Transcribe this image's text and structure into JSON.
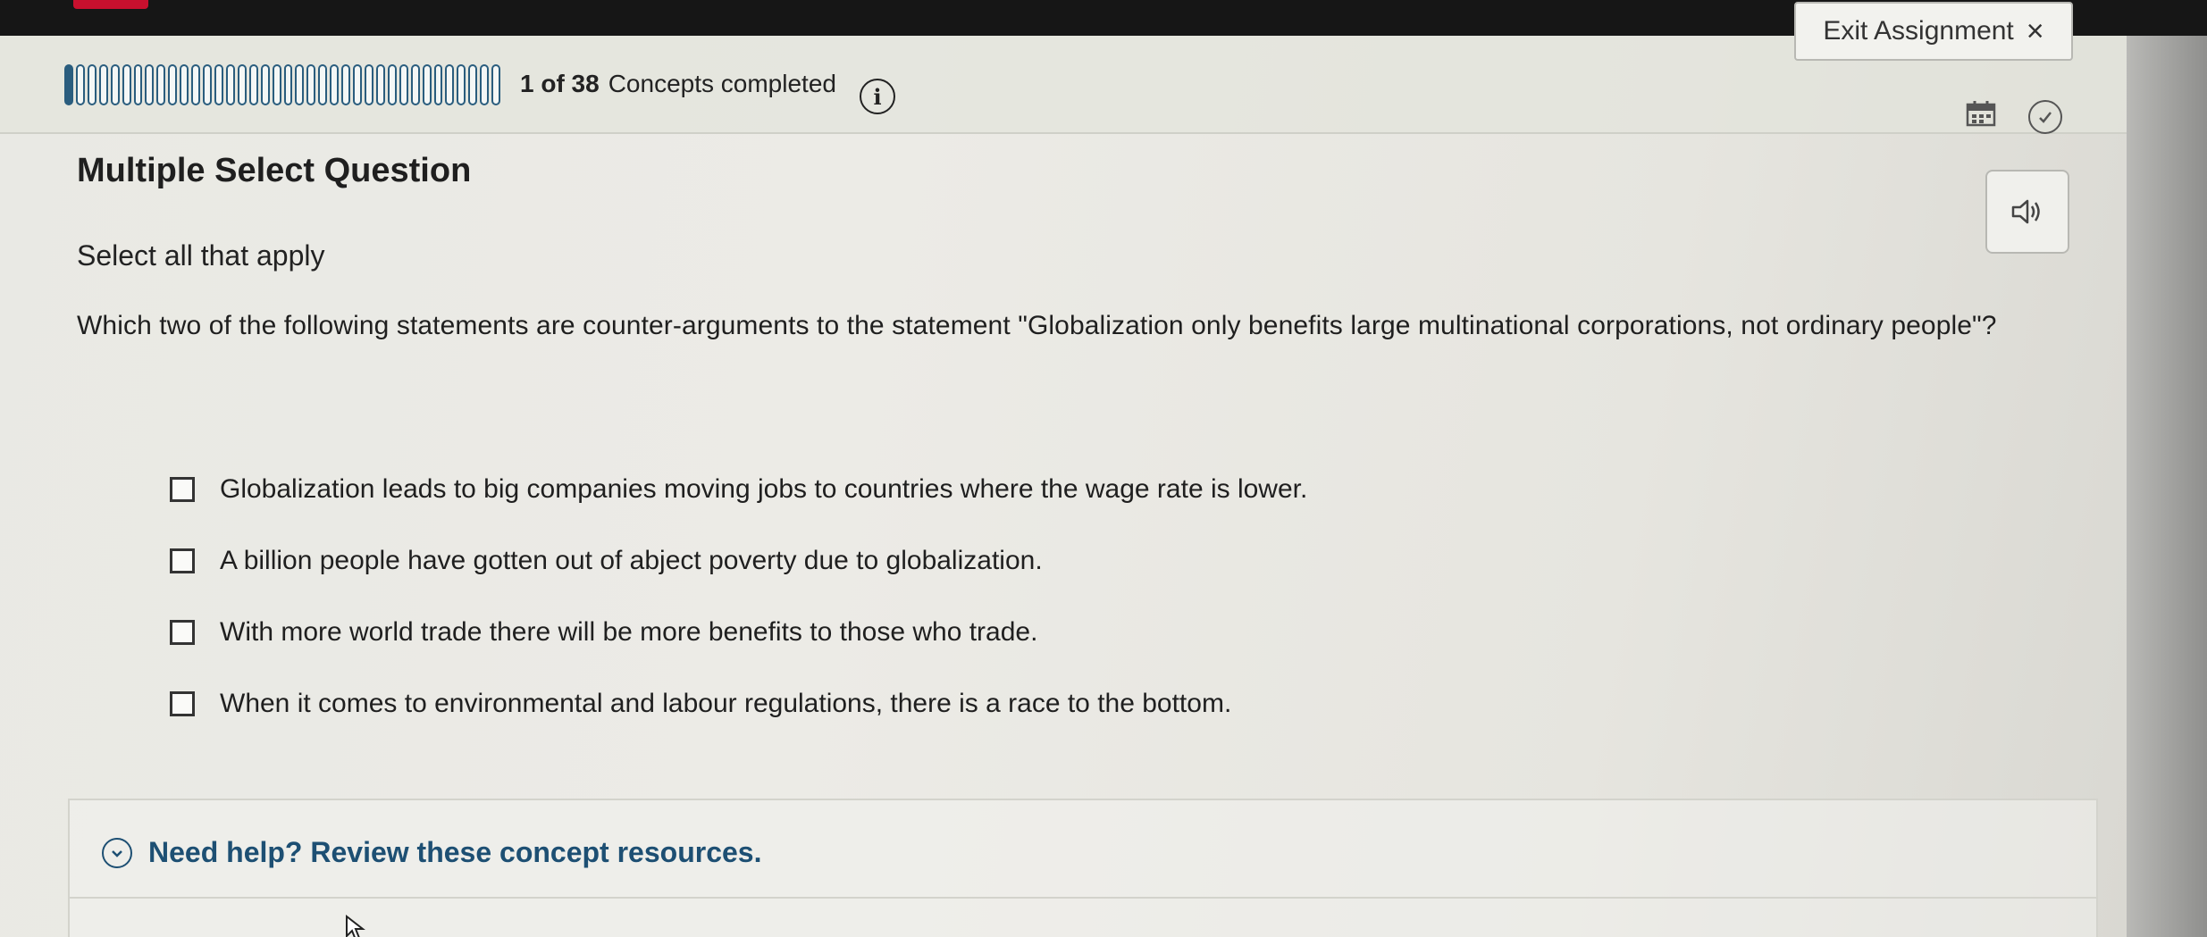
{
  "header": {
    "exit_label": "Exit Assignment",
    "exit_icon": "×",
    "progress_count": "1 of 38",
    "progress_label": "Concepts completed",
    "progress_completed": 1,
    "progress_total": 38,
    "info_glyph": "i"
  },
  "question": {
    "type": "Multiple Select Question",
    "instruction": "Select all that apply",
    "prompt": "Which two of the following statements are counter-arguments to the statement \"Globalization only benefits large multinational corporations, not ordinary people\"?",
    "options": [
      {
        "label": "Globalization leads to big companies moving jobs to countries where the wage rate is lower.",
        "checked": false
      },
      {
        "label": "A billion people have gotten out of abject poverty due to globalization.",
        "checked": false
      },
      {
        "label": "With more world trade there will be more benefits to those who trade.",
        "checked": false
      },
      {
        "label": "When it comes to environmental and labour regulations, there is a race to the bottom.",
        "checked": false
      }
    ]
  },
  "help": {
    "label": "Need help? Review these concept resources."
  },
  "icons": {
    "info": "info-icon",
    "calendar": "calendar-icon",
    "check": "check-circle-icon",
    "audio": "speaker-icon",
    "chevron": "chevron-down-icon",
    "close": "close-icon"
  },
  "colors": {
    "progress": "#2a5d7e",
    "help_link": "#1d4f73"
  }
}
